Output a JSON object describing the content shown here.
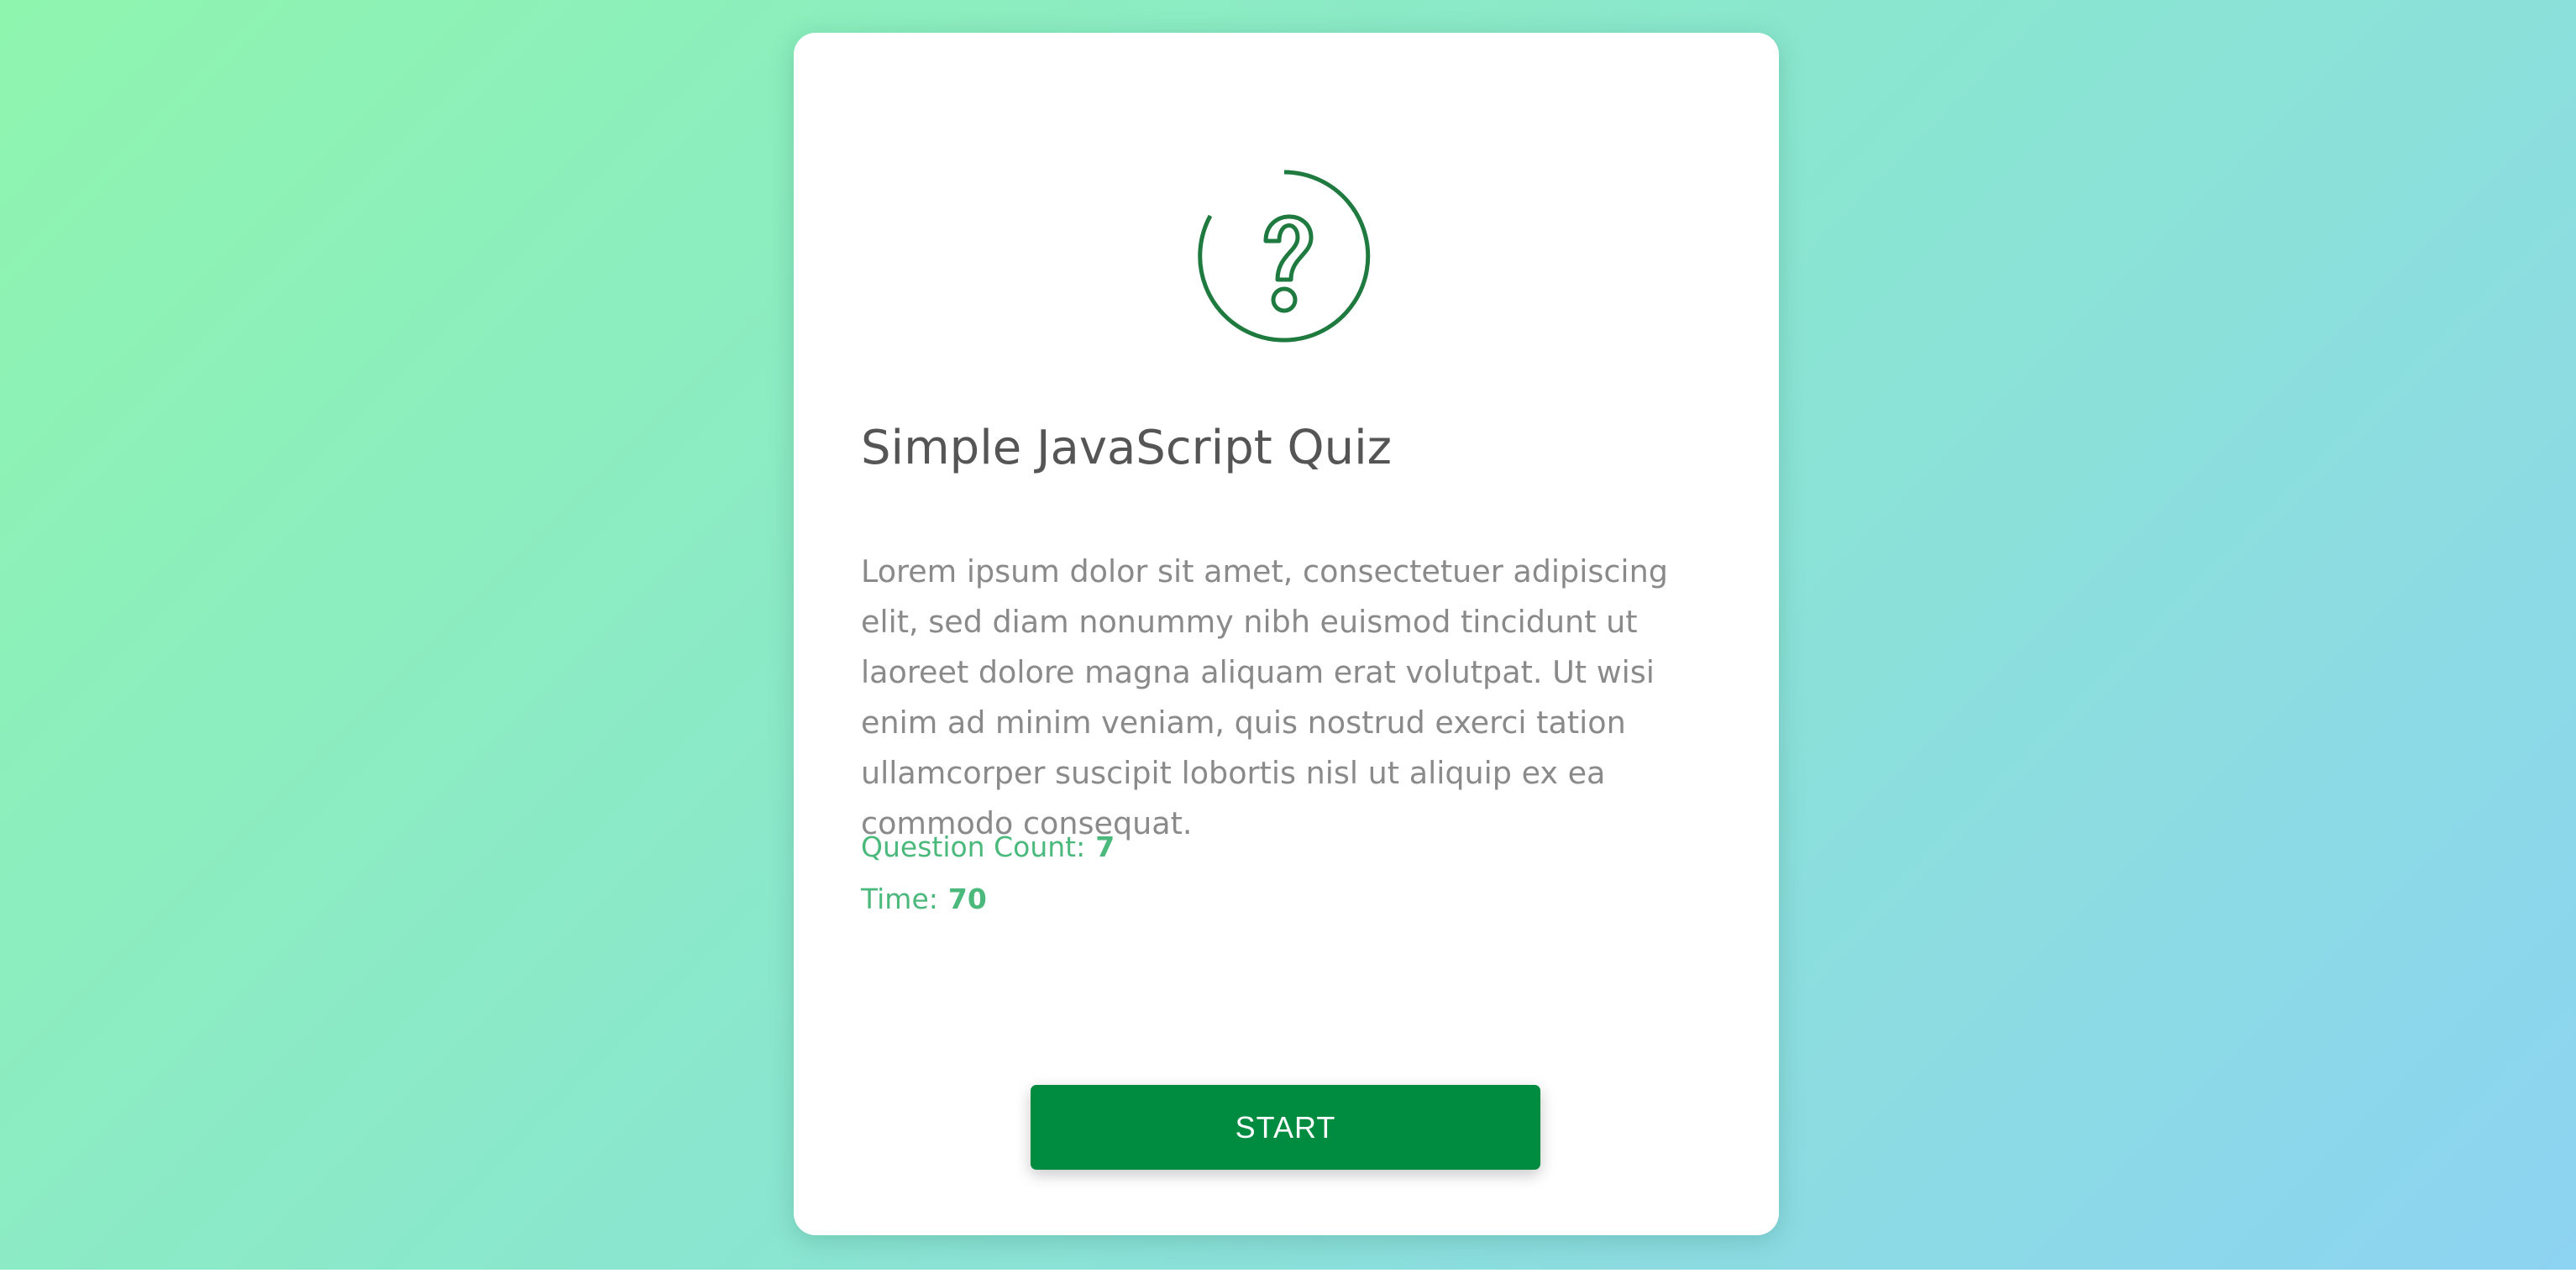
{
  "icon": "question-circle-icon",
  "colors": {
    "accent": "#1f7a3f",
    "button": "#008c40",
    "meta_text": "#4bb87c",
    "title": "#555555",
    "description": "#8a8a8a"
  },
  "quiz": {
    "title": "Simple JavaScript Quiz",
    "description": "Lorem ipsum dolor sit amet, consectetuer adipiscing elit, sed diam nonummy nibh euismod tincidunt ut laoreet dolore magna aliquam erat volutpat. Ut wisi enim ad minim veniam, quis nostrud exerci tation ullamcorper suscipit lobortis nisl ut aliquip ex ea commodo consequat.",
    "question_count_label": "Question Count:",
    "question_count": "7",
    "time_label": "Time:",
    "time": "70",
    "start_label": "START"
  }
}
